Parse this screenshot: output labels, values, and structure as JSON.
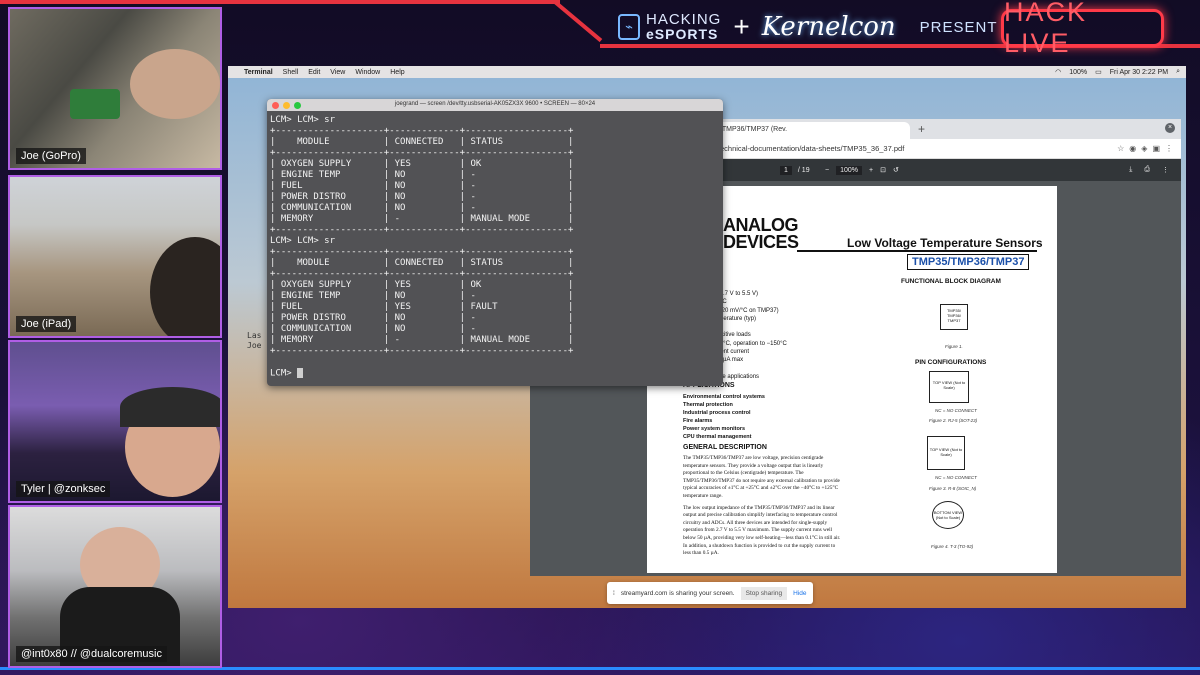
{
  "header": {
    "brand_line1": "HACKING",
    "brand_line2": "eSPORTS",
    "plus": "+",
    "kernelcon": "Kernelcon",
    "present": "PRESENT",
    "hack_live": "HACK LIVE"
  },
  "cams": [
    {
      "label": "Joe (GoPro)"
    },
    {
      "label": "Joe (iPad)"
    },
    {
      "label": "Tyler | @zonksec"
    },
    {
      "label": "@int0x80 // @dualcoremusic"
    }
  ],
  "menubar": {
    "apple": "",
    "app": "Terminal",
    "items": [
      "Shell",
      "Edit",
      "View",
      "Window",
      "Help"
    ],
    "battery": "100%",
    "datetime": "Fri Apr 30  2:22 PM"
  },
  "terminal": {
    "title": "joegrand — screen /dev/tty.usbserial-AK05ZX3X 9600 • SCREEN — 80×24",
    "lines": [
      "LCM> LCM> sr",
      "+--------------------+-------------+-------------------+",
      "|    MODULE          | CONNECTED   | STATUS            |",
      "+--------------------+-------------+-------------------+",
      "| OXYGEN SUPPLY      | YES         | OK                |",
      "| ENGINE TEMP        | NO          | -                 |",
      "| FUEL               | NO          | -                 |",
      "| POWER DISTRO       | NO          | -                 |",
      "| COMMUNICATION      | NO          | -                 |",
      "| MEMORY             | -           | MANUAL MODE       |",
      "+--------------------+-------------+-------------------+",
      "LCM> LCM> sr",
      "+--------------------+-------------+-------------------+",
      "|    MODULE          | CONNECTED   | STATUS            |",
      "+--------------------+-------------+-------------------+",
      "| OXYGEN SUPPLY      | YES         | OK                |",
      "| ENGINE TEMP        | NO          | -                 |",
      "| FUEL               | YES         | FAULT             |",
      "| POWER DISTRO       | NO          | -                 |",
      "| COMMUNICATION      | NO          | -                 |",
      "| MEMORY             | -           | MANUAL MODE       |",
      "+--------------------+-------------+-------------------+",
      "",
      "LCM> "
    ],
    "behind_text": "Las\nJoe"
  },
  "browser": {
    "tab_title": "5/TMP36/TMP37 (Rev.",
    "url": "echnical-documentation/data-sheets/TMP35_36_37.pdf",
    "page_current": "1",
    "page_total": "/ 19",
    "zoom": "100%"
  },
  "pdf": {
    "logo_line1": "ANALOG",
    "logo_line2": "DEVICES",
    "title": "Low Voltage Temperature Sensors",
    "parts": "TMP35/TMP36/TMP37",
    "features": [
      "ation (2.7 V to 5.5 V)",
      "ctly in °C",
      "factor (20 mV/°C on TMP37)",
      "er temperature (typ)",
      "(typ)",
      "e capacitive loads",
      "to +125°C, operation to −150°C",
      "quiescent current",
      "ent 0.5 µA max",
      "g",
      "tomotive applications"
    ],
    "applications_heading": "APPLICATIONS",
    "applications": [
      "Environmental control systems",
      "Thermal protection",
      "Industrial process control",
      "Fire alarms",
      "Power system monitors",
      "CPU thermal management"
    ],
    "general_heading": "GENERAL DESCRIPTION",
    "general_p1": "The TMP35/TMP36/TMP37 are low voltage, precision centigrade temperature sensors. They provide a voltage output that is linearly proportional to the Celsius (centigrade) temperature. The TMP35/TMP36/TMP37 do not require any external calibration to provide typical accuracies of ±1°C at +25°C and ±2°C over the −40°C to +125°C temperature range.",
    "general_p2": "The low output impedance of the TMP35/TMP36/TMP37 and its linear output and precise calibration simplify interfacing to temperature control circuitry and ADCs. All three devices are intended for single-supply operation from 2.7 V to 5.5 V maximum. The supply current runs well below 50 µA, providing very low self-heating—less than 0.1°C in still air. In addition, a shutdown function is provided to cut the supply current to less than 0.5 µA.",
    "fbd_heading": "FUNCTIONAL BLOCK DIAGRAM",
    "fbd_chip": "TMP35/ TMP36/ TMP37",
    "fbd_fig": "Figure 1.",
    "pc_heading": "PIN CONFIGURATIONS",
    "fig2": "Figure 2. RJ-5 (SOT-23)",
    "fig3": "Figure 3. R-8 (SOIC_N)",
    "fig4": "Figure 4. T-3 (TO-92)",
    "top_view": "TOP VIEW (Not to Scale)",
    "bottom_view": "BOTTOM VIEW (Not to Scale)",
    "nc_note": "NC = NO CONNECT"
  },
  "sharebar": {
    "text": "streamyard.com is sharing your screen.",
    "stop": "Stop sharing",
    "hide": "Hide"
  }
}
